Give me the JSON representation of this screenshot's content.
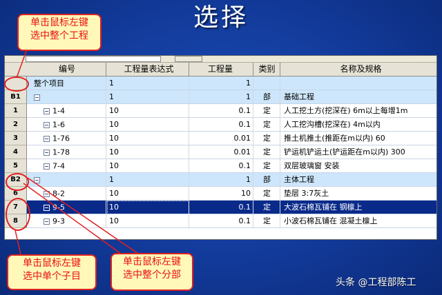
{
  "slide": {
    "title": "选择"
  },
  "callouts": {
    "top": [
      "单击鼠标左键",
      "选中整个工程"
    ],
    "left": [
      "单击鼠标左键",
      "选中单个子目"
    ],
    "right": [
      "单击鼠标左键",
      "选中整个分部"
    ]
  },
  "table": {
    "columns": [
      "编号",
      "工程量表达式",
      "工程量",
      "类别",
      "名称及规格"
    ],
    "rows": [
      {
        "head": "",
        "code": "整个项目",
        "expr": "1",
        "qty": "1",
        "cat": "",
        "name": "",
        "kind": "section",
        "tree": false
      },
      {
        "head": "B1",
        "code": "",
        "expr": "1",
        "qty": "1",
        "cat": "部",
        "name": "基础工程",
        "kind": "section",
        "tree": true
      },
      {
        "head": "1",
        "code": "1-4",
        "expr": "10",
        "qty": "0.1",
        "cat": "定",
        "name": "人工挖土方(挖深在) 6m以上每增1m",
        "kind": "item",
        "tree": true
      },
      {
        "head": "2",
        "code": "1-6",
        "expr": "10",
        "qty": "0.1",
        "cat": "定",
        "name": "人工挖沟槽(挖深在) 4m以内",
        "kind": "item",
        "tree": true
      },
      {
        "head": "3",
        "code": "1-76",
        "expr": "10",
        "qty": "0.01",
        "cat": "定",
        "name": "推土机推土(推距在m以内) 60",
        "kind": "item",
        "tree": true
      },
      {
        "head": "4",
        "code": "1-78",
        "expr": "10",
        "qty": "0.01",
        "cat": "定",
        "name": "铲运机铲运土(铲运距在m以内) 300",
        "kind": "item",
        "tree": true
      },
      {
        "head": "5",
        "code": "7-4",
        "expr": "10",
        "qty": "0.1",
        "cat": "定",
        "name": "双层玻璃窗 安装",
        "kind": "item",
        "tree": true
      },
      {
        "head": "B2",
        "code": "",
        "expr": "1",
        "qty": "1",
        "cat": "部",
        "name": "主体工程",
        "kind": "section",
        "tree": true
      },
      {
        "head": "6",
        "code": "8-2",
        "expr": "10",
        "qty": "10",
        "cat": "定",
        "name": "垫层 3:7灰土",
        "kind": "item",
        "tree": true
      },
      {
        "head": "7",
        "code": "9-5",
        "expr": "10",
        "qty": "0.1",
        "cat": "定",
        "name": "大波石棉瓦铺在 钢檩上",
        "kind": "selected",
        "tree": true
      },
      {
        "head": "8",
        "code": "9-3",
        "expr": "10",
        "qty": "0.1",
        "cat": "定",
        "name": "小波石棉瓦铺在 混凝土檩上",
        "kind": "item",
        "tree": true
      }
    ]
  },
  "watermark": "头条 @工程部陈工",
  "colors": {
    "background": "#123a9a",
    "section_row": "#cde6fb",
    "selected_row": "#0a2a8a",
    "callout_border": "#e02020",
    "callout_fill": "#fff8b8",
    "callout_text": "#e81010"
  }
}
